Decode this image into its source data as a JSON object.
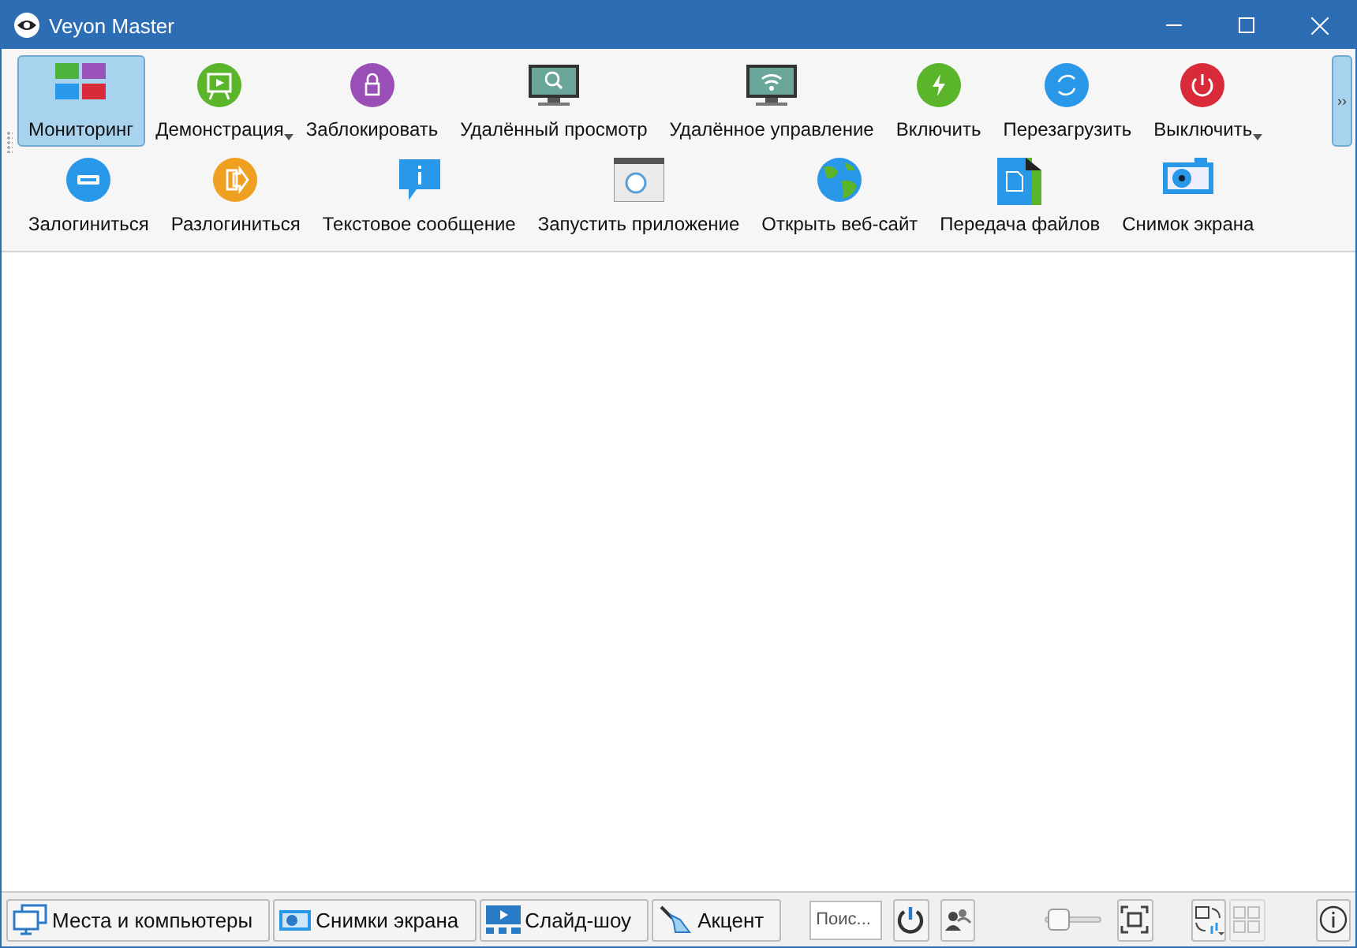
{
  "window": {
    "title": "Veyon Master"
  },
  "toolbar": {
    "first_row": [
      {
        "label": "Мониторинг",
        "selected": true,
        "dropdown": false
      },
      {
        "label": "Демонстрация",
        "selected": false,
        "dropdown": true
      },
      {
        "label": "Заблокировать",
        "selected": false,
        "dropdown": false
      },
      {
        "label": "Удалённый просмотр",
        "selected": false,
        "dropdown": false
      },
      {
        "label": "Удалённое управление",
        "selected": false,
        "dropdown": false
      },
      {
        "label": "Включить",
        "selected": false,
        "dropdown": false
      },
      {
        "label": "Перезагрузить",
        "selected": false,
        "dropdown": false
      },
      {
        "label": "Выключить",
        "selected": false,
        "dropdown": true
      }
    ],
    "second_row": [
      {
        "label": "Залогиниться",
        "selected": false
      },
      {
        "label": "Разлогиниться",
        "selected": false
      },
      {
        "label": "Текстовое сообщение",
        "selected": false
      },
      {
        "label": "Запустить приложение",
        "selected": false
      },
      {
        "label": "Открыть веб-сайт",
        "selected": false
      },
      {
        "label": "Передача файлов",
        "selected": false
      },
      {
        "label": "Снимок экрана",
        "selected": false
      }
    ],
    "extension": "››"
  },
  "bottom_bar": {
    "panels": [
      {
        "label": "Места и компьютеры",
        "selected": false
      },
      {
        "label": "Снимки экрана",
        "selected": false
      },
      {
        "label": "Слайд-шоу",
        "selected": false
      },
      {
        "label": "Акцент",
        "selected": false
      }
    ],
    "search": {
      "placeholder": "Поис..."
    },
    "zoom_slider": {
      "level": 0.05
    },
    "grid_button": {
      "disabled": true
    }
  }
}
